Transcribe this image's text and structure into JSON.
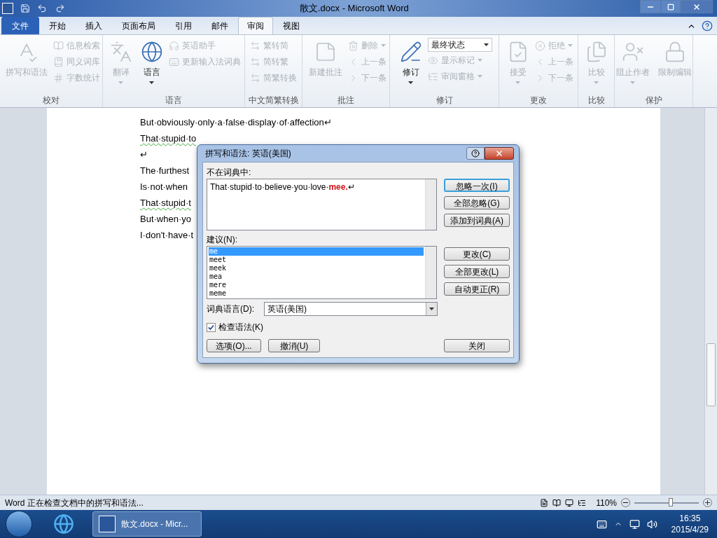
{
  "title_bar": {
    "title": "散文.docx - Microsoft Word"
  },
  "ribbon_tabs": [
    {
      "label": "文件",
      "kind": "file",
      "selected": false
    },
    {
      "label": "开始",
      "kind": "tab",
      "selected": false
    },
    {
      "label": "插入",
      "kind": "tab",
      "selected": false
    },
    {
      "label": "页面布局",
      "kind": "tab",
      "selected": false
    },
    {
      "label": "引用",
      "kind": "tab",
      "selected": false
    },
    {
      "label": "邮件",
      "kind": "tab",
      "selected": false
    },
    {
      "label": "审阅",
      "kind": "tab",
      "selected": true
    },
    {
      "label": "视图",
      "kind": "tab",
      "selected": false
    }
  ],
  "ribbon_groups": [
    {
      "label": "校对",
      "items": [
        {
          "label": "拼写和语法",
          "kind": "large",
          "disabled": true,
          "dropdown": false
        },
        {
          "label": "信息检索",
          "kind": "small",
          "disabled": true,
          "dropdown": false
        },
        {
          "label": "同义词库",
          "kind": "small",
          "disabled": true,
          "dropdown": false
        },
        {
          "label": "字数统计",
          "kind": "small",
          "disabled": true,
          "dropdown": false
        }
      ]
    },
    {
      "label": "语言",
      "items": [
        {
          "label": "翻译",
          "kind": "large",
          "disabled": true,
          "dropdown": true
        },
        {
          "label": "语言",
          "kind": "large",
          "disabled": false,
          "dropdown": true
        },
        {
          "label": "英语助手",
          "kind": "small",
          "disabled": true,
          "dropdown": false
        },
        {
          "label": "更新输入法词典",
          "kind": "small",
          "disabled": true,
          "dropdown": false
        }
      ]
    },
    {
      "label": "中文简繁转换",
      "items": [
        {
          "label": "繁转简",
          "kind": "small",
          "disabled": true,
          "dropdown": false
        },
        {
          "label": "简转繁",
          "kind": "small",
          "disabled": true,
          "dropdown": false
        },
        {
          "label": "简繁转换",
          "kind": "small",
          "disabled": true,
          "dropdown": false
        }
      ]
    },
    {
      "label": "批注",
      "items": [
        {
          "label": "新建批注",
          "kind": "large",
          "disabled": true,
          "dropdown": false
        },
        {
          "label": "删除",
          "kind": "small",
          "disabled": true,
          "dropdown": true
        },
        {
          "label": "上一条",
          "kind": "small",
          "disabled": true,
          "dropdown": false
        },
        {
          "label": "下一条",
          "kind": "small",
          "disabled": true,
          "dropdown": false
        }
      ]
    },
    {
      "label": "修订",
      "items": [
        {
          "label": "修订",
          "kind": "large",
          "disabled": false,
          "dropdown": true
        },
        {
          "label": "最终状态",
          "kind": "select",
          "disabled": false,
          "dropdown": true
        },
        {
          "label": "显示标记",
          "kind": "small",
          "disabled": true,
          "dropdown": true
        },
        {
          "label": "审阅窗格",
          "kind": "small",
          "disabled": true,
          "dropdown": true
        }
      ]
    },
    {
      "label": "更改",
      "items": [
        {
          "label": "接受",
          "kind": "large",
          "disabled": true,
          "dropdown": true
        },
        {
          "label": "拒绝",
          "kind": "small",
          "disabled": true,
          "dropdown": true
        },
        {
          "label": "上一条",
          "kind": "small",
          "disabled": true,
          "dropdown": false
        },
        {
          "label": "下一条",
          "kind": "small",
          "disabled": true,
          "dropdown": false
        }
      ]
    },
    {
      "label": "比较",
      "items": [
        {
          "label": "比较",
          "kind": "large",
          "disabled": true,
          "dropdown": true
        }
      ]
    },
    {
      "label": "保护",
      "items": [
        {
          "label": "阻止作者",
          "kind": "large",
          "disabled": true,
          "dropdown": true
        },
        {
          "label": "限制编辑",
          "kind": "large",
          "disabled": true,
          "dropdown": false
        }
      ]
    }
  ],
  "document_lines": [
    {
      "text": "But·obviously·only·a·false·display·of·affection↵",
      "grammar_flag": false
    },
    {
      "text": "That·stupid·to",
      "grammar_flag": true
    },
    {
      "text": "↵",
      "grammar_flag": false
    },
    {
      "text": "The·furthest",
      "grammar_flag": false
    },
    {
      "text": "Is·not·when",
      "grammar_flag": false
    },
    {
      "text": "That·stupid·t",
      "grammar_flag": true
    },
    {
      "text": "But·when·yo",
      "grammar_flag": false
    },
    {
      "text": "I·don't·have·t",
      "grammar_flag": false
    }
  ],
  "dialog": {
    "title": "拼写和语法: 英语(美国)",
    "not_in_dictionary_label": "不在词典中:",
    "sentence": "That·stupid·to·believe·you·love·**mee.**↵",
    "suggestions_label": "建议(N):",
    "suggestions": [
      {
        "text": "me",
        "selected": true
      },
      {
        "text": "meet",
        "selected": false
      },
      {
        "text": "meek",
        "selected": false
      },
      {
        "text": "mea",
        "selected": false
      },
      {
        "text": "mere",
        "selected": false
      },
      {
        "text": "meme",
        "selected": false
      }
    ],
    "upper_buttons": [
      {
        "label": "忽略一次(I)",
        "focused": true
      },
      {
        "label": "全部忽略(G)",
        "focused": false
      },
      {
        "label": "添加到词典(A)",
        "focused": false
      }
    ],
    "lower_buttons": [
      {
        "label": "更改(C)",
        "focused": false
      },
      {
        "label": "全部更改(L)",
        "focused": false
      },
      {
        "label": "自动更正(R)",
        "focused": false
      }
    ],
    "dictionary_language_label": "词典语言(D):",
    "dictionary_language": "英语(美国)",
    "check_grammar": {
      "label": "检查语法(K)",
      "checked": true
    },
    "options_button": "选项(O)...",
    "undo_button": "撤消(U)",
    "close_button": "关闭"
  },
  "status_bar": {
    "message": "Word 正在检查文档中的拼写和语法...",
    "zoom": "110%",
    "zoom_level": {
      "level": 0.56
    }
  },
  "taskbar": {
    "task": "散文.docx - Micr...",
    "time": "16:35",
    "date": "2015/4/29"
  }
}
